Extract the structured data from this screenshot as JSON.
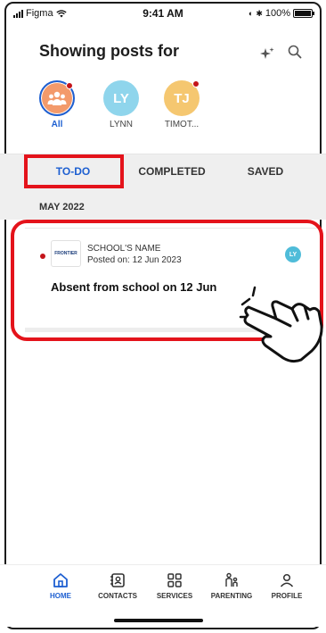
{
  "status_bar": {
    "carrier": "Figma",
    "time": "9:41 AM",
    "battery_text": "100%"
  },
  "header": {
    "title": "Showing posts for"
  },
  "avatars": [
    {
      "initials": "",
      "label": "All",
      "color": "#f39a6b",
      "active": true
    },
    {
      "initials": "LY",
      "label": "LYNN",
      "color": "#8fd5ec"
    },
    {
      "initials": "TJ",
      "label": "TIMOT...",
      "color": "#f5c770"
    }
  ],
  "tabs": [
    {
      "label": "TO-DO",
      "active": true
    },
    {
      "label": "COMPLETED"
    },
    {
      "label": "SAVED"
    }
  ],
  "section": {
    "label": "MAY 2022"
  },
  "post": {
    "logo_text": "FRONTIER",
    "school_name": "SCHOOL'S NAME",
    "posted_on": "Posted on: 12 Jun 2023",
    "avatar_initials": "LY",
    "title": "Absent from school on 12 Jun"
  },
  "nav": [
    {
      "label": "HOME",
      "icon": "home-icon",
      "active": true
    },
    {
      "label": "CONTACTS",
      "icon": "contacts-icon"
    },
    {
      "label": "SERVICES",
      "icon": "grid-icon"
    },
    {
      "label": "PARENTING",
      "icon": "family-icon"
    },
    {
      "label": "PROFILE",
      "icon": "profile-icon"
    }
  ],
  "colors": {
    "accent": "#1d5fd1",
    "highlight": "#e4131b",
    "unread": "#c4141a"
  }
}
